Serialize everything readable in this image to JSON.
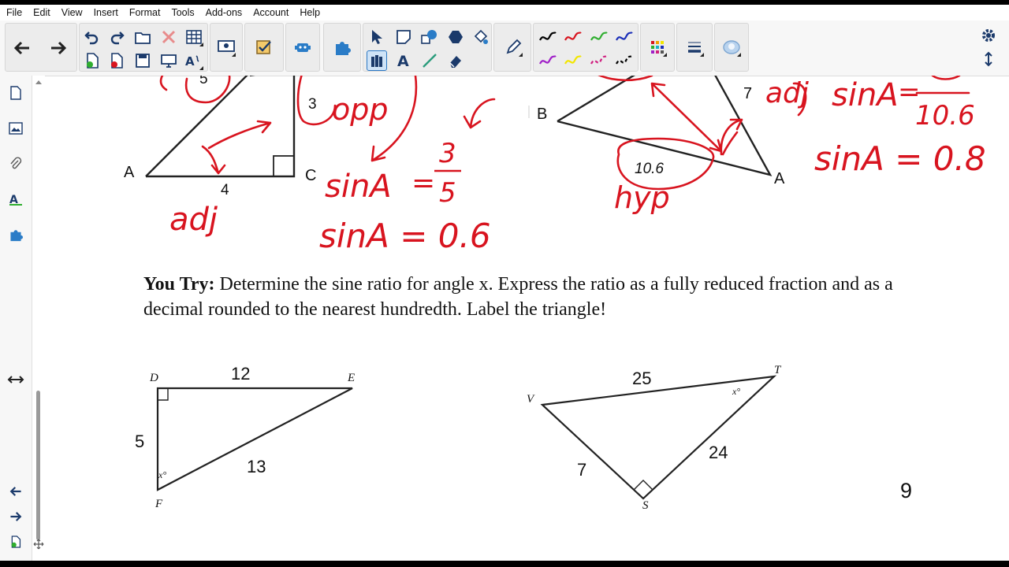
{
  "menu": [
    "File",
    "Edit",
    "View",
    "Insert",
    "Format",
    "Tools",
    "Add-ons",
    "Account",
    "Help"
  ],
  "toolbar": {
    "pen_colors": [
      "#000000",
      "#d8141f",
      "#2fae2f",
      "#1b2fb8",
      "#a020c8",
      "#f2e600",
      "#d02080",
      "#000000"
    ]
  },
  "example1": {
    "vertex_a": "A",
    "vertex_c": "C",
    "side_bottom": "4",
    "side_right": "3",
    "side_hyp": "5",
    "ink": {
      "opp": "opp",
      "adj": "adj",
      "eq1_lhs": "sinA",
      "eq1_num": "3",
      "eq1_den": "5",
      "eq2": "sinA = 0.6"
    }
  },
  "example2": {
    "vertex_b": "B",
    "vertex_a": "A",
    "side_right": "7",
    "side_bottom": "10.6",
    "ink": {
      "adj": "adj",
      "hyp": "hyp",
      "eq1_lhs": "sinA",
      "eq1_den": "10.6",
      "eq2": "sinA = 0.8"
    }
  },
  "prompt": {
    "lead": "You Try:",
    "text": " Determine the sine ratio for angle x. Express the ratio as a fully reduced fraction and as a decimal rounded to the nearest hundredth. Label the triangle!"
  },
  "triangle1": {
    "v_d": "D",
    "v_e": "E",
    "v_f": "F",
    "top": "12",
    "left": "5",
    "hyp": "13",
    "angle": "x°"
  },
  "triangle2": {
    "v_v": "V",
    "v_t": "T",
    "v_s": "S",
    "top": "25",
    "right": "24",
    "left": "7",
    "angle": "x°"
  },
  "page_number": "9"
}
